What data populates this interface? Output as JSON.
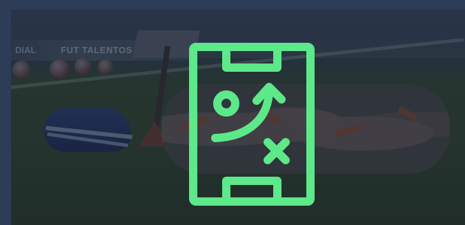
{
  "photo": {
    "banner_left_text": "DIAL",
    "banner_text": "FUT TALENTOS"
  },
  "icon": {
    "name": "tactics-board-icon",
    "color": "#5de88a"
  },
  "colors": {
    "frame": "#2d3c57",
    "accent": "#5de88a"
  }
}
